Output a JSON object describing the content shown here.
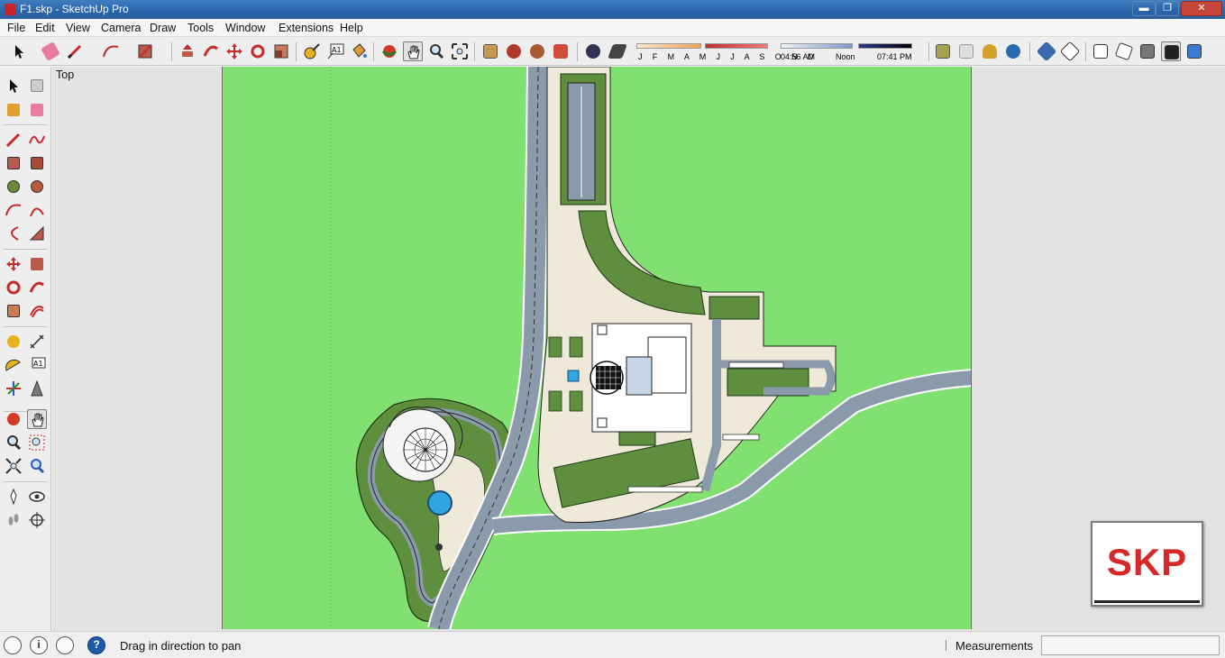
{
  "window": {
    "title": "F1.skp - SketchUp Pro",
    "app_icon": "sketchup-logo-icon",
    "controls": [
      "minimize-icon",
      "maximize-icon",
      "close-icon"
    ]
  },
  "menu": {
    "items": [
      "File",
      "Edit",
      "View",
      "Camera",
      "Draw",
      "Tools",
      "Window",
      "Extensions",
      "Help"
    ]
  },
  "shadow_panel": {
    "months": "J F M A M J J A S O N D",
    "time_start": "04:56 AM",
    "time_noon": "Noon",
    "time_end": "07:41 PM"
  },
  "viewport": {
    "scene_label": "Top"
  },
  "watermark": {
    "text": "SKP"
  },
  "status": {
    "icons": [
      "geo-location-icon",
      "credits-icon",
      "user-account-icon",
      "help-icon"
    ],
    "help_glyph": "?",
    "info_glyph": "i",
    "message": "Drag in direction to pan",
    "measurements_label": "Measurements",
    "measurements_value": ""
  },
  "colors": {
    "ground": "#80e070",
    "road": "#8a9aab",
    "lawn": "#5f8f3e",
    "paving": "#eee9d8"
  }
}
